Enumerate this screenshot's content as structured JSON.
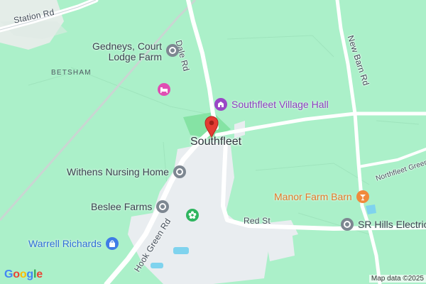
{
  "map": {
    "town_label": "Southfleet",
    "area_label": "BETSHAM",
    "roads": {
      "station_rd": "Station Rd",
      "dale_rd": "Dale Rd",
      "new_barn_rd": "New Barn Rd",
      "northfleet_green": "Northfleet Green R",
      "red_st": "Red St",
      "hook_green_rd": "Hook Green Rd"
    },
    "pois": [
      {
        "label_line1": "Gedneys, Court",
        "label_line2": "Lodge Farm",
        "icon": "info-pin-icon",
        "color": "#7d8791"
      },
      {
        "label": "",
        "icon": "hotel-bed-icon",
        "color": "#e04fb3"
      },
      {
        "label": "Southfleet Village Hall",
        "icon": "village-hall-icon",
        "color": "#9a47c6"
      },
      {
        "label": "Withens Nursing Home",
        "icon": "info-pin-icon",
        "color": "#7d8791"
      },
      {
        "label": "Manor Farm Barn",
        "icon": "cocktail-bar-icon",
        "color": "#f08a3b"
      },
      {
        "label": "Beslee Farms",
        "icon": "info-pin-icon",
        "color": "#7d8791"
      },
      {
        "label": "",
        "icon": "flower-garden-icon",
        "color": "#2fb55f"
      },
      {
        "label": "SR Hills Electric",
        "icon": "info-pin-icon",
        "color": "#7d8791"
      },
      {
        "label": "Warrell Richards",
        "icon": "shopping-bag-icon",
        "color": "#3f7ce6"
      }
    ],
    "marker": {
      "color": "#e33b32",
      "icon": "location-marker-icon"
    },
    "branding": {
      "logo": "Google",
      "attribution": "Map data ©2025"
    },
    "colors": {
      "land": "#abf0c9",
      "built_up": "#e9edf0",
      "road": "#ffffff",
      "water": "#7fd3ee",
      "park": "#85e3a4"
    }
  }
}
